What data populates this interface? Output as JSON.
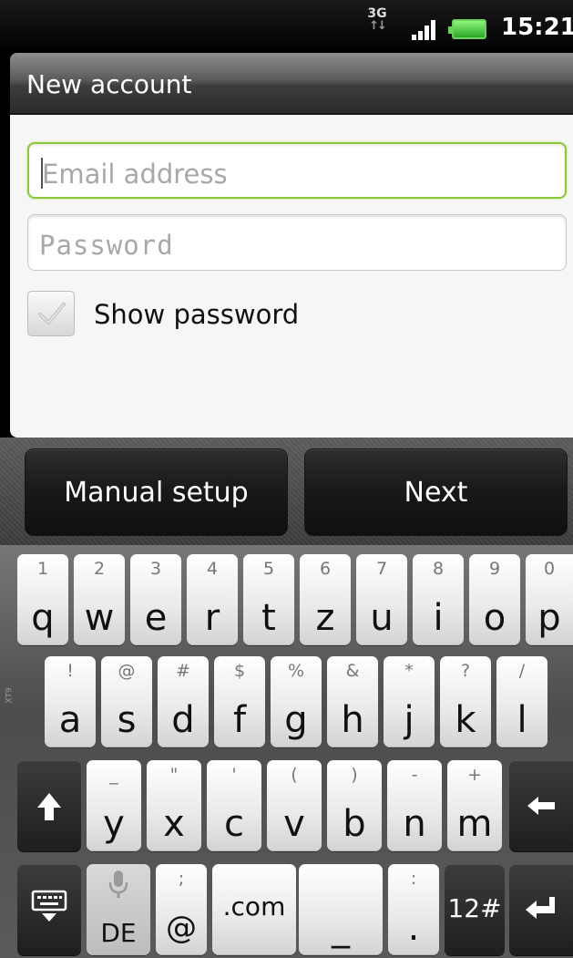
{
  "status_bar": {
    "network": "3G",
    "time": "15:21",
    "icons": [
      "data-arrows-icon",
      "signal-icon",
      "battery-icon"
    ]
  },
  "dialog": {
    "title": "New account",
    "email_placeholder": "Email address",
    "password_placeholder": "Password",
    "show_password_label": "Show password",
    "show_password_checked": false
  },
  "actions": {
    "manual_setup": "Manual setup",
    "next": "Next"
  },
  "keyboard": {
    "row1": [
      {
        "main": "q",
        "sub": "1"
      },
      {
        "main": "w",
        "sub": "2"
      },
      {
        "main": "e",
        "sub": "3"
      },
      {
        "main": "r",
        "sub": "4"
      },
      {
        "main": "t",
        "sub": "5"
      },
      {
        "main": "z",
        "sub": "6"
      },
      {
        "main": "u",
        "sub": "7"
      },
      {
        "main": "i",
        "sub": "8"
      },
      {
        "main": "o",
        "sub": "9"
      },
      {
        "main": "p",
        "sub": "0"
      }
    ],
    "row2": [
      {
        "main": "a",
        "sub": "!"
      },
      {
        "main": "s",
        "sub": "@"
      },
      {
        "main": "d",
        "sub": "#"
      },
      {
        "main": "f",
        "sub": "$"
      },
      {
        "main": "g",
        "sub": "%"
      },
      {
        "main": "h",
        "sub": "&"
      },
      {
        "main": "j",
        "sub": "*"
      },
      {
        "main": "k",
        "sub": "?"
      },
      {
        "main": "l",
        "sub": "/"
      }
    ],
    "row3": [
      {
        "main": "y",
        "sub": "_"
      },
      {
        "main": "x",
        "sub": "\""
      },
      {
        "main": "c",
        "sub": "'"
      },
      {
        "main": "v",
        "sub": "("
      },
      {
        "main": "b",
        "sub": ")"
      },
      {
        "main": "n",
        "sub": "-"
      },
      {
        "main": "m",
        "sub": "+"
      }
    ],
    "language": "DE",
    "at_key": {
      "main": "@",
      "sub": ";"
    },
    "dotcom": ".com",
    "underscore": "_",
    "period_key": {
      "main": ".",
      "sub": ":"
    },
    "symbols": "12#",
    "side_label": "XT9"
  },
  "colors": {
    "focus_border": "#8cc63e",
    "battery": "#4fd14a"
  }
}
